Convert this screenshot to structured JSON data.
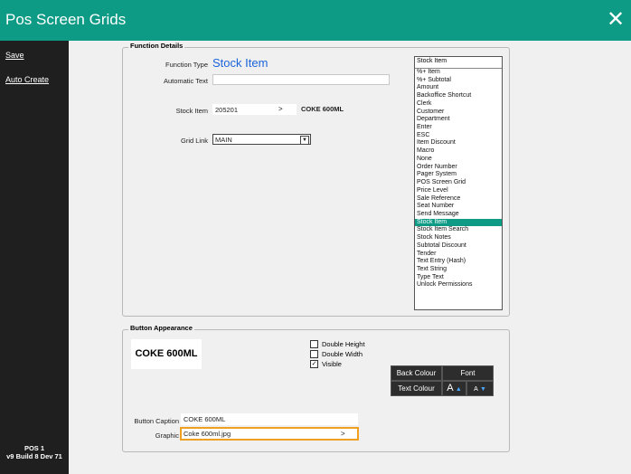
{
  "window": {
    "title": "Pos Screen Grids",
    "close_icon": "✕"
  },
  "sidebar": {
    "items": [
      {
        "label": "Save"
      },
      {
        "label": "Auto Create"
      }
    ],
    "footer": {
      "line1": "POS 1",
      "line2": "v9 Build 8 Dev 71"
    }
  },
  "function_details": {
    "title": "Function Details",
    "function_type_label": "Function Type",
    "function_type_value": "Stock Item",
    "automatic_text_label": "Automatic Text",
    "automatic_text_value": "",
    "stock_item_label": "Stock Item",
    "stock_item_code": "205201",
    "stock_item_arrow": ">",
    "stock_item_name": "COKE 600ML",
    "grid_link_label": "Grid Link",
    "grid_link_value": "MAIN",
    "list_header": "Stock Item",
    "list_options": [
      "%+ Item",
      "%+ Subtotal",
      "Amount",
      "Backoffice Shortcut",
      "Clerk",
      "Customer",
      "Department",
      "Enter",
      "ESC",
      "Item Discount",
      "Macro",
      "None",
      "Order Number",
      "Pager System",
      "POS Screen Grid",
      "Price Level",
      "Sale Reference",
      "Seat Number",
      "Send Message",
      "Stock Item",
      "Stock Item Search",
      "Stock Notes",
      "Subtotal Discount",
      "Tender",
      "Text Entry (Hash)",
      "Text String",
      "Type Text",
      "Unlock Permissions"
    ],
    "selected_option": "Stock Item"
  },
  "button_appearance": {
    "title": "Button Appearance",
    "preview_text": "COKE 600ML",
    "checkboxes": [
      {
        "label": "Double Height",
        "checked": false
      },
      {
        "label": "Double Width",
        "checked": false
      },
      {
        "label": "Visible",
        "checked": true
      }
    ],
    "back_colour": "Back Colour",
    "font": "Font",
    "text_colour": "Text Colour",
    "font_large_a": "A",
    "font_small_a": "A",
    "caption_label": "Button Caption",
    "caption_value": "COKE 600ML",
    "graphic_label": "Graphic",
    "graphic_value": "Coke 600ml.jpg",
    "graphic_arrow": ">"
  },
  "colors": {
    "accent": "#0e9b86",
    "sidebar": "#1f1f1f",
    "link": "#1a63d9",
    "highlight_border": "#f0a020"
  }
}
